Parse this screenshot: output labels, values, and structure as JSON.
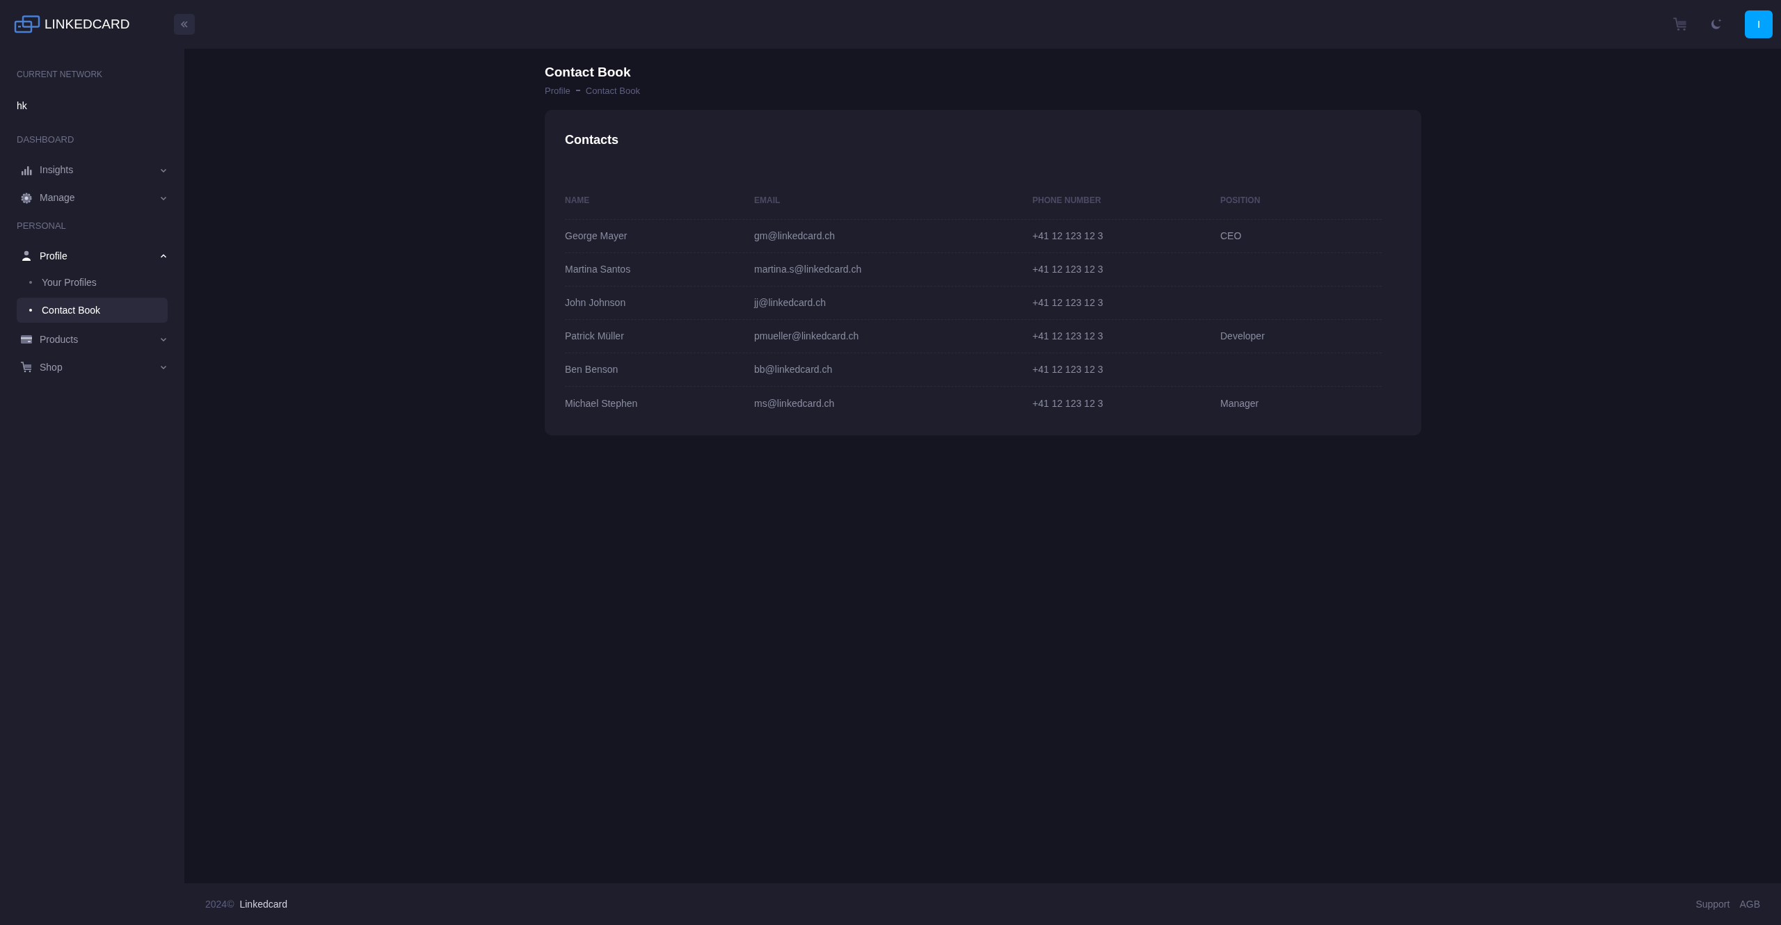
{
  "header": {
    "logo_text": "LINKEDCARD",
    "avatar_initial": "I"
  },
  "sidebar": {
    "network_label": "CURRENT NETWORK",
    "network": "hk",
    "sections": [
      {
        "label": "DASHBOARD",
        "items": [
          {
            "label": "Insights",
            "kind": "chart",
            "expanded": false
          },
          {
            "label": "Manage",
            "kind": "gear",
            "expanded": false
          }
        ]
      },
      {
        "label": "PERSONAL",
        "items": [
          {
            "label": "Profile",
            "kind": "person",
            "expanded": true,
            "children": [
              {
                "label": "Your Profiles",
                "selected": false
              },
              {
                "label": "Contact Book",
                "selected": true
              }
            ]
          },
          {
            "label": "Products",
            "kind": "card",
            "expanded": false
          },
          {
            "label": "Shop",
            "kind": "cart",
            "expanded": false
          }
        ]
      }
    ]
  },
  "page": {
    "title": "Contact Book",
    "breadcrumb": [
      "Profile",
      "Contact Book"
    ]
  },
  "card": {
    "title": "Contacts",
    "columns": [
      "NAME",
      "EMAIL",
      "PHONE NUMBER",
      "POSITION"
    ],
    "rows": [
      {
        "name": "George Mayer",
        "email": "gm@linkedcard.ch",
        "phone": "+41 12 123 12 3",
        "position": "CEO"
      },
      {
        "name": "Martina Santos",
        "email": "martina.s@linkedcard.ch",
        "phone": "+41 12 123 12 3"
      },
      {
        "name": "John Johnson",
        "email": "jj@linkedcard.ch",
        "phone": "+41 12 123 12 3"
      },
      {
        "name": "Patrick Müller",
        "email": "pmueller@linkedcard.ch",
        "phone": "+41 12 123 12 3",
        "position": "Developer"
      },
      {
        "name": "Ben Benson",
        "email": "bb@linkedcard.ch",
        "phone": "+41 12 123 12 3"
      },
      {
        "name": "Michael Stephen",
        "email": "ms@linkedcard.ch",
        "phone": "+41 12 123 12 3",
        "position": "Manager"
      }
    ]
  },
  "footer": {
    "year": "2024©",
    "brand": "Linkedcard",
    "links": [
      "Support",
      "AGB"
    ]
  }
}
